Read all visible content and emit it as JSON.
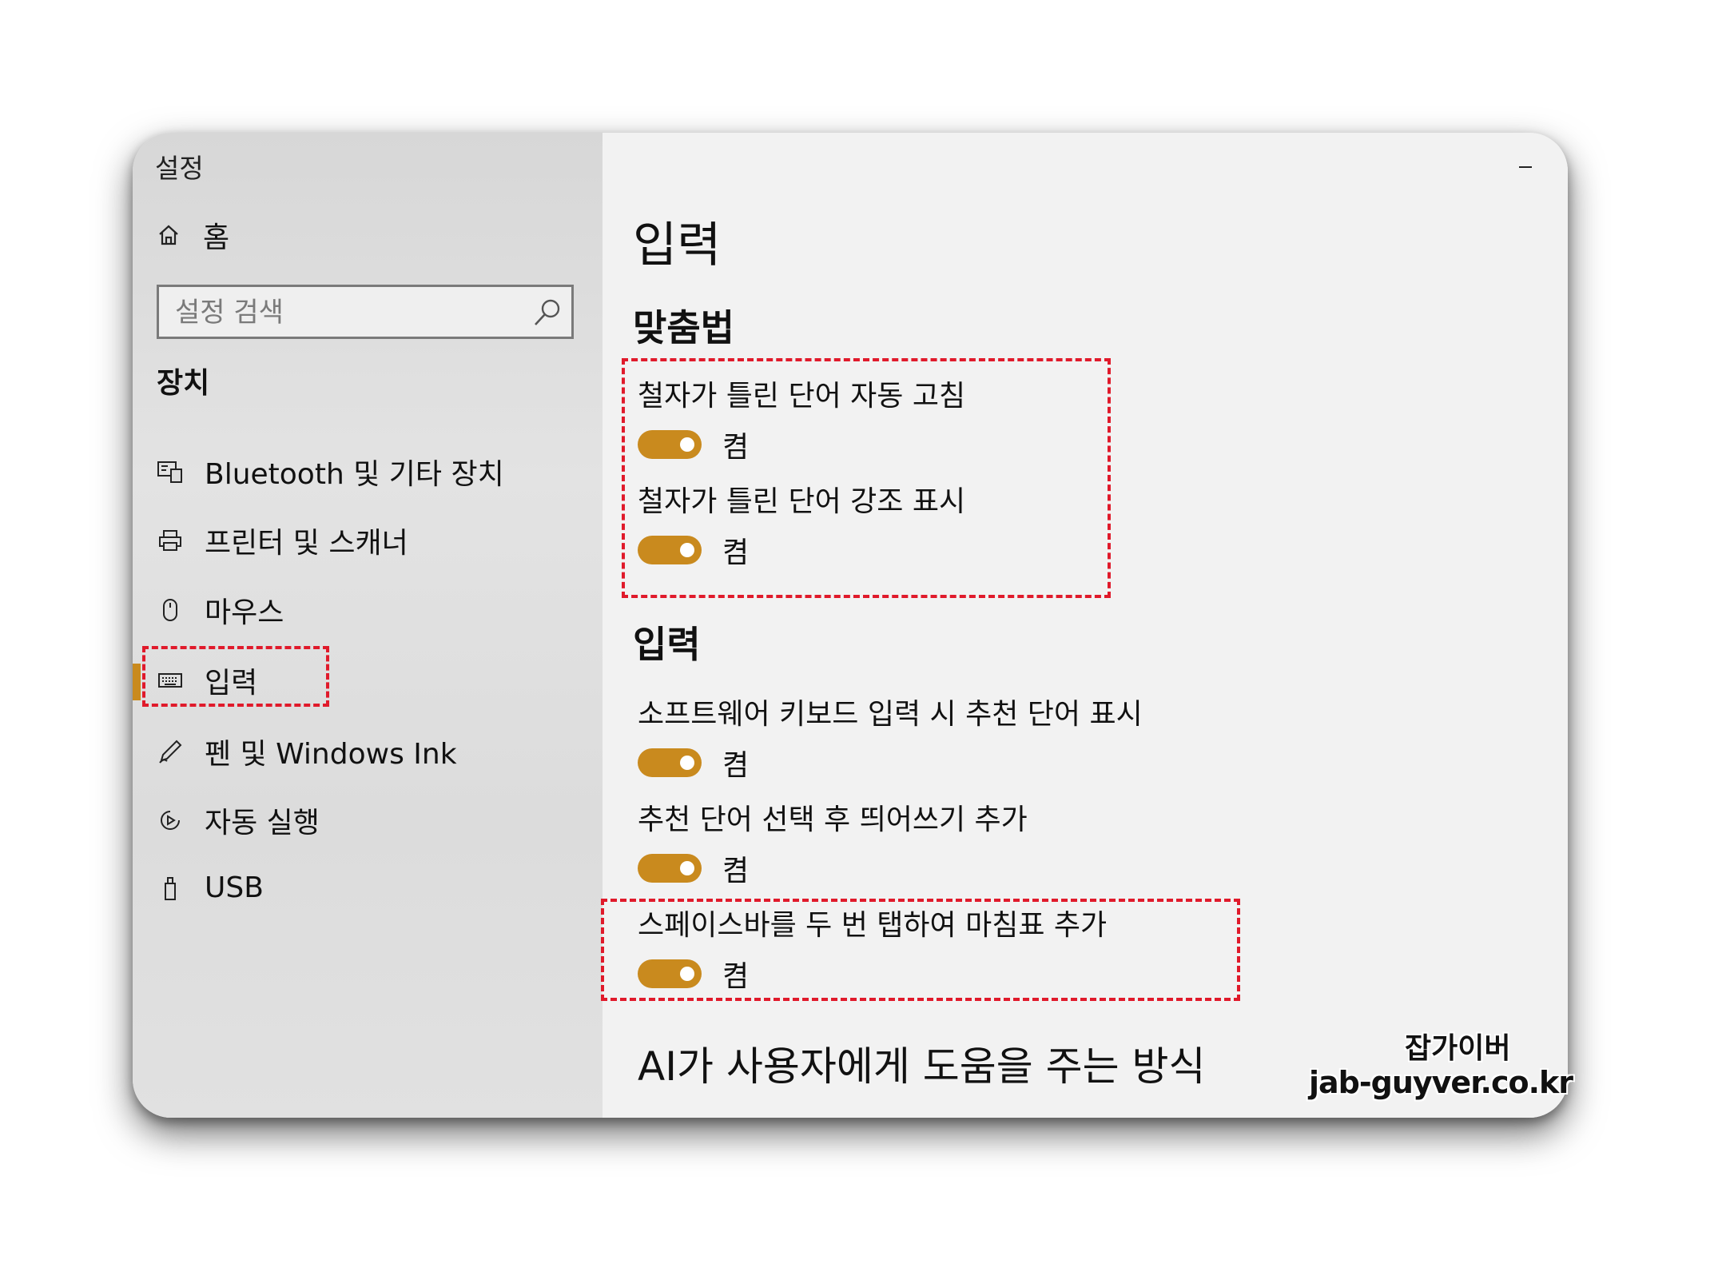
{
  "window": {
    "title": "설정"
  },
  "sidebar": {
    "home_label": "홈",
    "search_placeholder": "설정 검색",
    "section_title": "장치",
    "items": [
      {
        "label": "Bluetooth 및 기타 장치",
        "icon": "bluetooth-devices-icon"
      },
      {
        "label": "프린터 및 스캐너",
        "icon": "printer-icon"
      },
      {
        "label": "마우스",
        "icon": "mouse-icon"
      },
      {
        "label": "입력",
        "icon": "keyboard-icon",
        "selected": true
      },
      {
        "label": "펜 및 Windows Ink",
        "icon": "pen-icon"
      },
      {
        "label": "자동 실행",
        "icon": "autoplay-icon"
      },
      {
        "label": "USB",
        "icon": "usb-icon"
      }
    ]
  },
  "main": {
    "page_title": "입력",
    "spelling": {
      "heading": "맞춤법",
      "autocorrect": {
        "label": "철자가 틀린 단어 자동 고침",
        "state": "켬"
      },
      "highlight": {
        "label": "철자가 틀린 단어 강조 표시",
        "state": "켬"
      }
    },
    "typing": {
      "heading": "입력",
      "suggestions": {
        "label": "소프트웨어 키보드 입력 시 추천 단어 표시",
        "state": "켬"
      },
      "add_space": {
        "label": "추천 단어 선택 후 띄어쓰기 추가",
        "state": "켬"
      },
      "double_space_period": {
        "label": "스페이스바를 두 번 탭하여 마침표 추가",
        "state": "켬"
      }
    },
    "ai_heading": "AI가 사용자에게 도움을 주는 방식"
  },
  "watermark": {
    "line1": "잡가이버",
    "line2": "jab-guyver.co.kr"
  },
  "colors": {
    "accent": "#c98a1e",
    "highlight_box": "#e01a2b"
  }
}
